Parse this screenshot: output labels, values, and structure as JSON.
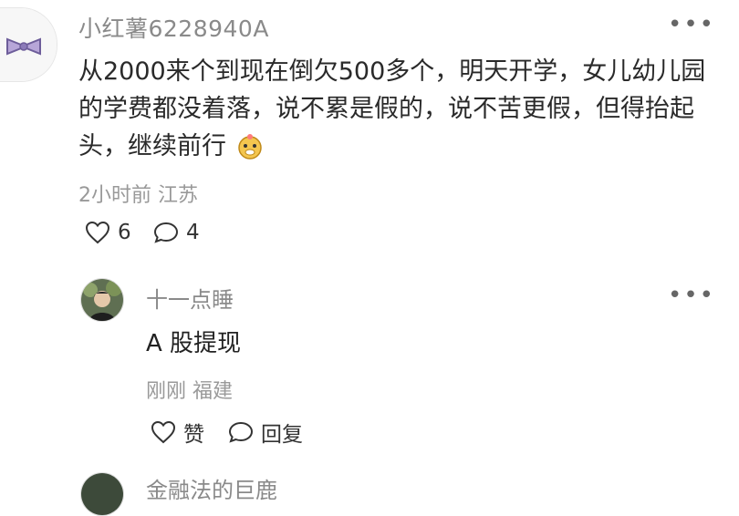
{
  "comment": {
    "username": "小红薯6228940A",
    "content": "从2000来个到现在倒欠500多个，明天开学，女儿幼儿园的学费都没着落，说不累是假的，说不苦更假，但得抬起头，继续前行",
    "meta": "2小时前  江苏",
    "likes": "6",
    "replies": "4"
  },
  "reply": {
    "username": "十一点睡",
    "content": "A 股提现",
    "meta": "刚刚  福建",
    "like_label": "赞",
    "reply_label": "回复"
  },
  "next_reply": {
    "username_partial": "金融法的巨鹿"
  },
  "icons": {
    "more": "more-icon",
    "like": "heart-icon",
    "comment": "chat-bubble-icon",
    "avatar_main": "bow-avatar",
    "emoji": "dog-face-emoji"
  },
  "colors": {
    "text": "#222222",
    "secondary": "#8a8a8a",
    "meta": "#999999"
  }
}
